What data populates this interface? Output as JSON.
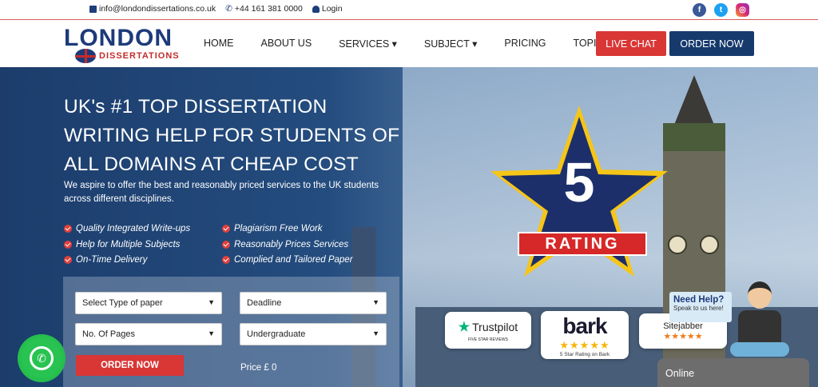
{
  "topbar": {
    "email": "info@londondissertations.co.uk",
    "phone": "+44 161 381 0000",
    "login": "Login"
  },
  "logo": {
    "line1": "LONDON",
    "line2": "DISSERTATIONS"
  },
  "nav": {
    "items": [
      "HOME",
      "ABOUT US",
      "SERVICES ▾",
      "SUBJECT ▾",
      "PRICING",
      "TOPICS"
    ],
    "live_chat": "LIVE CHAT",
    "order_now": "ORDER NOW"
  },
  "hero": {
    "title_line1": "UK's #1 TOP DISSERTATION",
    "title_line2": "WRITING HELP FOR STUDENTS OF",
    "title_line3": "ALL DOMAINS AT CHEAP COST",
    "subtitle": "We aspire to offer the best and reasonably priced services to the UK students across different disciplines.",
    "features_left": [
      "Quality Integrated Write-ups",
      "Help for Multiple Subjects",
      "On-Time Delivery"
    ],
    "features_right": [
      "Plagiarism Free Work",
      "Reasonably Prices Services",
      "Complied and Tailored Paper"
    ]
  },
  "form": {
    "paper_type": "Select Type of paper",
    "deadline": "Deadline",
    "pages": "No. Of Pages",
    "level": "Undergraduate",
    "order_button": "ORDER NOW",
    "price": "Price £ 0"
  },
  "rating": {
    "number": "5",
    "label": "RATING"
  },
  "badges": {
    "trustpilot": "Trustpilot",
    "trustpilot_sub": "FIVE STAR REVIEWS",
    "bark": "bark",
    "bark_stars": "★★★★★",
    "bark_sub": "5 Star Rating on Bark",
    "sitejabber": "Sitejabber",
    "sitejabber_stars": "★★★★★"
  },
  "help": {
    "title": "Need Help?",
    "sub": "Speak to us here!"
  },
  "chat": {
    "status": "Online"
  },
  "colors": {
    "brand_navy": "#173a6d",
    "brand_red": "#d93636",
    "star_yellow": "#f5c518"
  }
}
